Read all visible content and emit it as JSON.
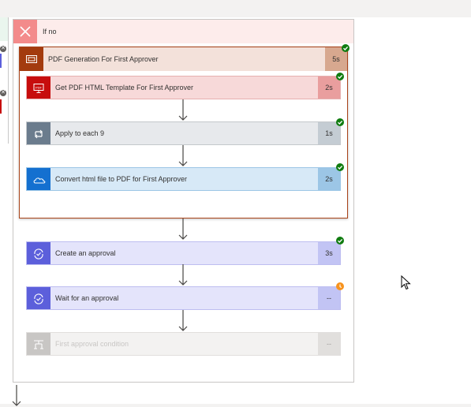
{
  "colors": {
    "branch_no_header": "#fdeceb",
    "branch_no_icon": "#f38b8b",
    "scope_accent": "#a33b0e",
    "success_badge": "#107c10",
    "waiting_badge": "#f7931e"
  },
  "branch": {
    "label": "If no",
    "icon": "close-icon"
  },
  "scope": {
    "title": "PDF Generation For First Approver",
    "duration": "5s",
    "status": "succeeded"
  },
  "steps": [
    {
      "label": "Get PDF HTML Template For First Approver",
      "duration": "2s",
      "icon": "pdf-icon",
      "status": "succeeded"
    },
    {
      "label": "Apply to each 9",
      "duration": "1s",
      "icon": "loop-icon",
      "status": "succeeded"
    },
    {
      "label": "Convert html file to PDF for First Approver",
      "duration": "2s",
      "icon": "onedrive-icon",
      "status": "succeeded"
    },
    {
      "label": "Create an approval",
      "duration": "3s",
      "icon": "approvals-icon",
      "status": "succeeded"
    },
    {
      "label": "Wait for an approval",
      "duration": "--",
      "icon": "approvals-icon",
      "status": "running"
    },
    {
      "label": "First approval condition",
      "duration": "--",
      "icon": "condition-icon",
      "status": "skipped"
    }
  ]
}
